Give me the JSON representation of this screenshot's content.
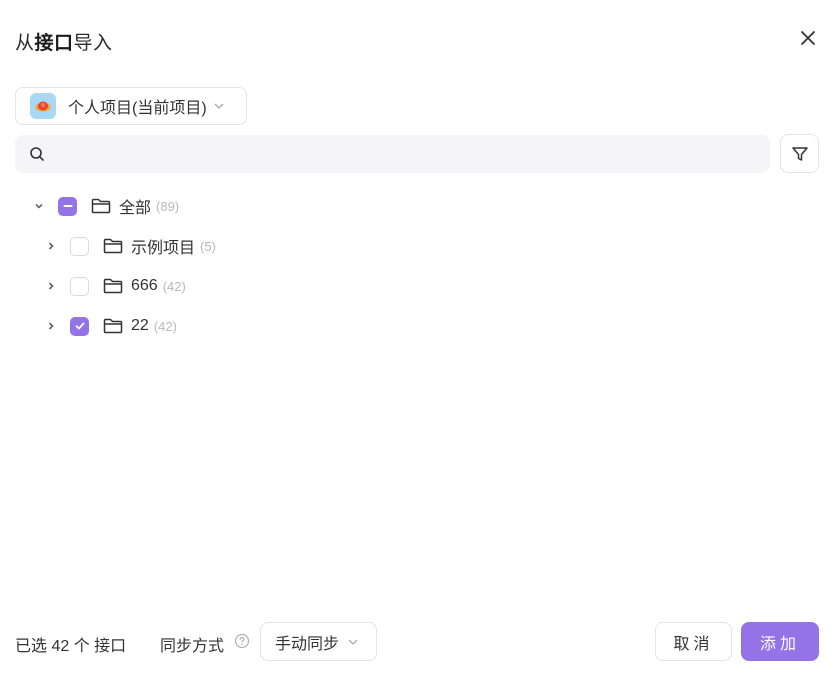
{
  "dialog": {
    "title_prefix": "从",
    "title_bold": "接口",
    "title_suffix": "导入",
    "close_icon": "close-icon"
  },
  "project": {
    "name": "个人项目(当前项目)",
    "avatar_icon": "project-avatar-icon"
  },
  "search": {
    "placeholder": "",
    "value": ""
  },
  "tree": {
    "root": {
      "label": "全部",
      "count": "(89)",
      "state": "indeterminate",
      "expanded": true
    },
    "children": [
      {
        "label": "示例项目",
        "count": "(5)",
        "checked": false
      },
      {
        "label": "666",
        "count": "(42)",
        "checked": false
      },
      {
        "label": "22",
        "count": "(42)",
        "checked": true
      }
    ]
  },
  "footer": {
    "selected_text": "已选 42 个 接口",
    "sync_label": "同步方式",
    "sync_value": "手动同步",
    "cancel_label": "取消",
    "add_label": "添加"
  },
  "colors": {
    "accent": "#9373e6",
    "border": "#e4e4e7",
    "search_bg": "#f5f5f7"
  }
}
